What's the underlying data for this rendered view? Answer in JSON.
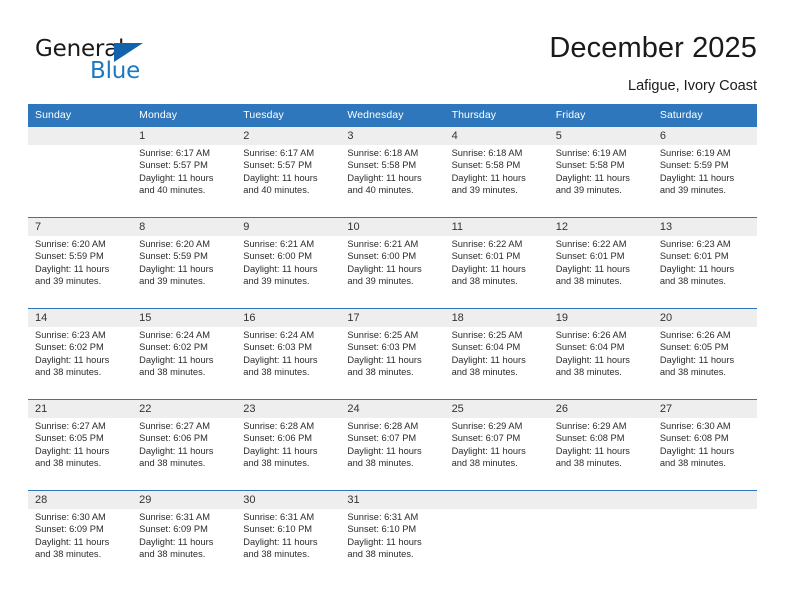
{
  "brand": {
    "name_part1": "General",
    "name_part2": "Blue",
    "flag_icon": "blue-triangle-flag-icon",
    "accent_color": "#1b79c4"
  },
  "header": {
    "title": "December 2025",
    "location": "Lafigue, Ivory Coast"
  },
  "theme": {
    "header_bg": "#2f77bc",
    "header_text": "#ffffff",
    "daynum_bg": "#eeeeee",
    "row_border": "#2f77bc"
  },
  "calendar": {
    "weekday_headers": [
      "Sunday",
      "Monday",
      "Tuesday",
      "Wednesday",
      "Thursday",
      "Friday",
      "Saturday"
    ],
    "labels": {
      "sunrise": "Sunrise:",
      "sunset": "Sunset:",
      "daylight": "Daylight:"
    },
    "weeks": [
      [
        {
          "day": "",
          "empty": true
        },
        {
          "day": "1",
          "sunrise": "Sunrise: 6:17 AM",
          "sunset": "Sunset: 5:57 PM",
          "daylight_line1": "Daylight: 11 hours",
          "daylight_line2": "and 40 minutes."
        },
        {
          "day": "2",
          "sunrise": "Sunrise: 6:17 AM",
          "sunset": "Sunset: 5:57 PM",
          "daylight_line1": "Daylight: 11 hours",
          "daylight_line2": "and 40 minutes."
        },
        {
          "day": "3",
          "sunrise": "Sunrise: 6:18 AM",
          "sunset": "Sunset: 5:58 PM",
          "daylight_line1": "Daylight: 11 hours",
          "daylight_line2": "and 40 minutes."
        },
        {
          "day": "4",
          "sunrise": "Sunrise: 6:18 AM",
          "sunset": "Sunset: 5:58 PM",
          "daylight_line1": "Daylight: 11 hours",
          "daylight_line2": "and 39 minutes."
        },
        {
          "day": "5",
          "sunrise": "Sunrise: 6:19 AM",
          "sunset": "Sunset: 5:58 PM",
          "daylight_line1": "Daylight: 11 hours",
          "daylight_line2": "and 39 minutes."
        },
        {
          "day": "6",
          "sunrise": "Sunrise: 6:19 AM",
          "sunset": "Sunset: 5:59 PM",
          "daylight_line1": "Daylight: 11 hours",
          "daylight_line2": "and 39 minutes."
        }
      ],
      [
        {
          "day": "7",
          "sunrise": "Sunrise: 6:20 AM",
          "sunset": "Sunset: 5:59 PM",
          "daylight_line1": "Daylight: 11 hours",
          "daylight_line2": "and 39 minutes."
        },
        {
          "day": "8",
          "sunrise": "Sunrise: 6:20 AM",
          "sunset": "Sunset: 5:59 PM",
          "daylight_line1": "Daylight: 11 hours",
          "daylight_line2": "and 39 minutes."
        },
        {
          "day": "9",
          "sunrise": "Sunrise: 6:21 AM",
          "sunset": "Sunset: 6:00 PM",
          "daylight_line1": "Daylight: 11 hours",
          "daylight_line2": "and 39 minutes."
        },
        {
          "day": "10",
          "sunrise": "Sunrise: 6:21 AM",
          "sunset": "Sunset: 6:00 PM",
          "daylight_line1": "Daylight: 11 hours",
          "daylight_line2": "and 39 minutes."
        },
        {
          "day": "11",
          "sunrise": "Sunrise: 6:22 AM",
          "sunset": "Sunset: 6:01 PM",
          "daylight_line1": "Daylight: 11 hours",
          "daylight_line2": "and 38 minutes."
        },
        {
          "day": "12",
          "sunrise": "Sunrise: 6:22 AM",
          "sunset": "Sunset: 6:01 PM",
          "daylight_line1": "Daylight: 11 hours",
          "daylight_line2": "and 38 minutes."
        },
        {
          "day": "13",
          "sunrise": "Sunrise: 6:23 AM",
          "sunset": "Sunset: 6:01 PM",
          "daylight_line1": "Daylight: 11 hours",
          "daylight_line2": "and 38 minutes."
        }
      ],
      [
        {
          "day": "14",
          "sunrise": "Sunrise: 6:23 AM",
          "sunset": "Sunset: 6:02 PM",
          "daylight_line1": "Daylight: 11 hours",
          "daylight_line2": "and 38 minutes."
        },
        {
          "day": "15",
          "sunrise": "Sunrise: 6:24 AM",
          "sunset": "Sunset: 6:02 PM",
          "daylight_line1": "Daylight: 11 hours",
          "daylight_line2": "and 38 minutes."
        },
        {
          "day": "16",
          "sunrise": "Sunrise: 6:24 AM",
          "sunset": "Sunset: 6:03 PM",
          "daylight_line1": "Daylight: 11 hours",
          "daylight_line2": "and 38 minutes."
        },
        {
          "day": "17",
          "sunrise": "Sunrise: 6:25 AM",
          "sunset": "Sunset: 6:03 PM",
          "daylight_line1": "Daylight: 11 hours",
          "daylight_line2": "and 38 minutes."
        },
        {
          "day": "18",
          "sunrise": "Sunrise: 6:25 AM",
          "sunset": "Sunset: 6:04 PM",
          "daylight_line1": "Daylight: 11 hours",
          "daylight_line2": "and 38 minutes."
        },
        {
          "day": "19",
          "sunrise": "Sunrise: 6:26 AM",
          "sunset": "Sunset: 6:04 PM",
          "daylight_line1": "Daylight: 11 hours",
          "daylight_line2": "and 38 minutes."
        },
        {
          "day": "20",
          "sunrise": "Sunrise: 6:26 AM",
          "sunset": "Sunset: 6:05 PM",
          "daylight_line1": "Daylight: 11 hours",
          "daylight_line2": "and 38 minutes."
        }
      ],
      [
        {
          "day": "21",
          "sunrise": "Sunrise: 6:27 AM",
          "sunset": "Sunset: 6:05 PM",
          "daylight_line1": "Daylight: 11 hours",
          "daylight_line2": "and 38 minutes."
        },
        {
          "day": "22",
          "sunrise": "Sunrise: 6:27 AM",
          "sunset": "Sunset: 6:06 PM",
          "daylight_line1": "Daylight: 11 hours",
          "daylight_line2": "and 38 minutes."
        },
        {
          "day": "23",
          "sunrise": "Sunrise: 6:28 AM",
          "sunset": "Sunset: 6:06 PM",
          "daylight_line1": "Daylight: 11 hours",
          "daylight_line2": "and 38 minutes."
        },
        {
          "day": "24",
          "sunrise": "Sunrise: 6:28 AM",
          "sunset": "Sunset: 6:07 PM",
          "daylight_line1": "Daylight: 11 hours",
          "daylight_line2": "and 38 minutes."
        },
        {
          "day": "25",
          "sunrise": "Sunrise: 6:29 AM",
          "sunset": "Sunset: 6:07 PM",
          "daylight_line1": "Daylight: 11 hours",
          "daylight_line2": "and 38 minutes."
        },
        {
          "day": "26",
          "sunrise": "Sunrise: 6:29 AM",
          "sunset": "Sunset: 6:08 PM",
          "daylight_line1": "Daylight: 11 hours",
          "daylight_line2": "and 38 minutes."
        },
        {
          "day": "27",
          "sunrise": "Sunrise: 6:30 AM",
          "sunset": "Sunset: 6:08 PM",
          "daylight_line1": "Daylight: 11 hours",
          "daylight_line2": "and 38 minutes."
        }
      ],
      [
        {
          "day": "28",
          "sunrise": "Sunrise: 6:30 AM",
          "sunset": "Sunset: 6:09 PM",
          "daylight_line1": "Daylight: 11 hours",
          "daylight_line2": "and 38 minutes."
        },
        {
          "day": "29",
          "sunrise": "Sunrise: 6:31 AM",
          "sunset": "Sunset: 6:09 PM",
          "daylight_line1": "Daylight: 11 hours",
          "daylight_line2": "and 38 minutes."
        },
        {
          "day": "30",
          "sunrise": "Sunrise: 6:31 AM",
          "sunset": "Sunset: 6:10 PM",
          "daylight_line1": "Daylight: 11 hours",
          "daylight_line2": "and 38 minutes."
        },
        {
          "day": "31",
          "sunrise": "Sunrise: 6:31 AM",
          "sunset": "Sunset: 6:10 PM",
          "daylight_line1": "Daylight: 11 hours",
          "daylight_line2": "and 38 minutes."
        },
        {
          "day": "",
          "empty": true
        },
        {
          "day": "",
          "empty": true
        },
        {
          "day": "",
          "empty": true
        }
      ]
    ]
  }
}
